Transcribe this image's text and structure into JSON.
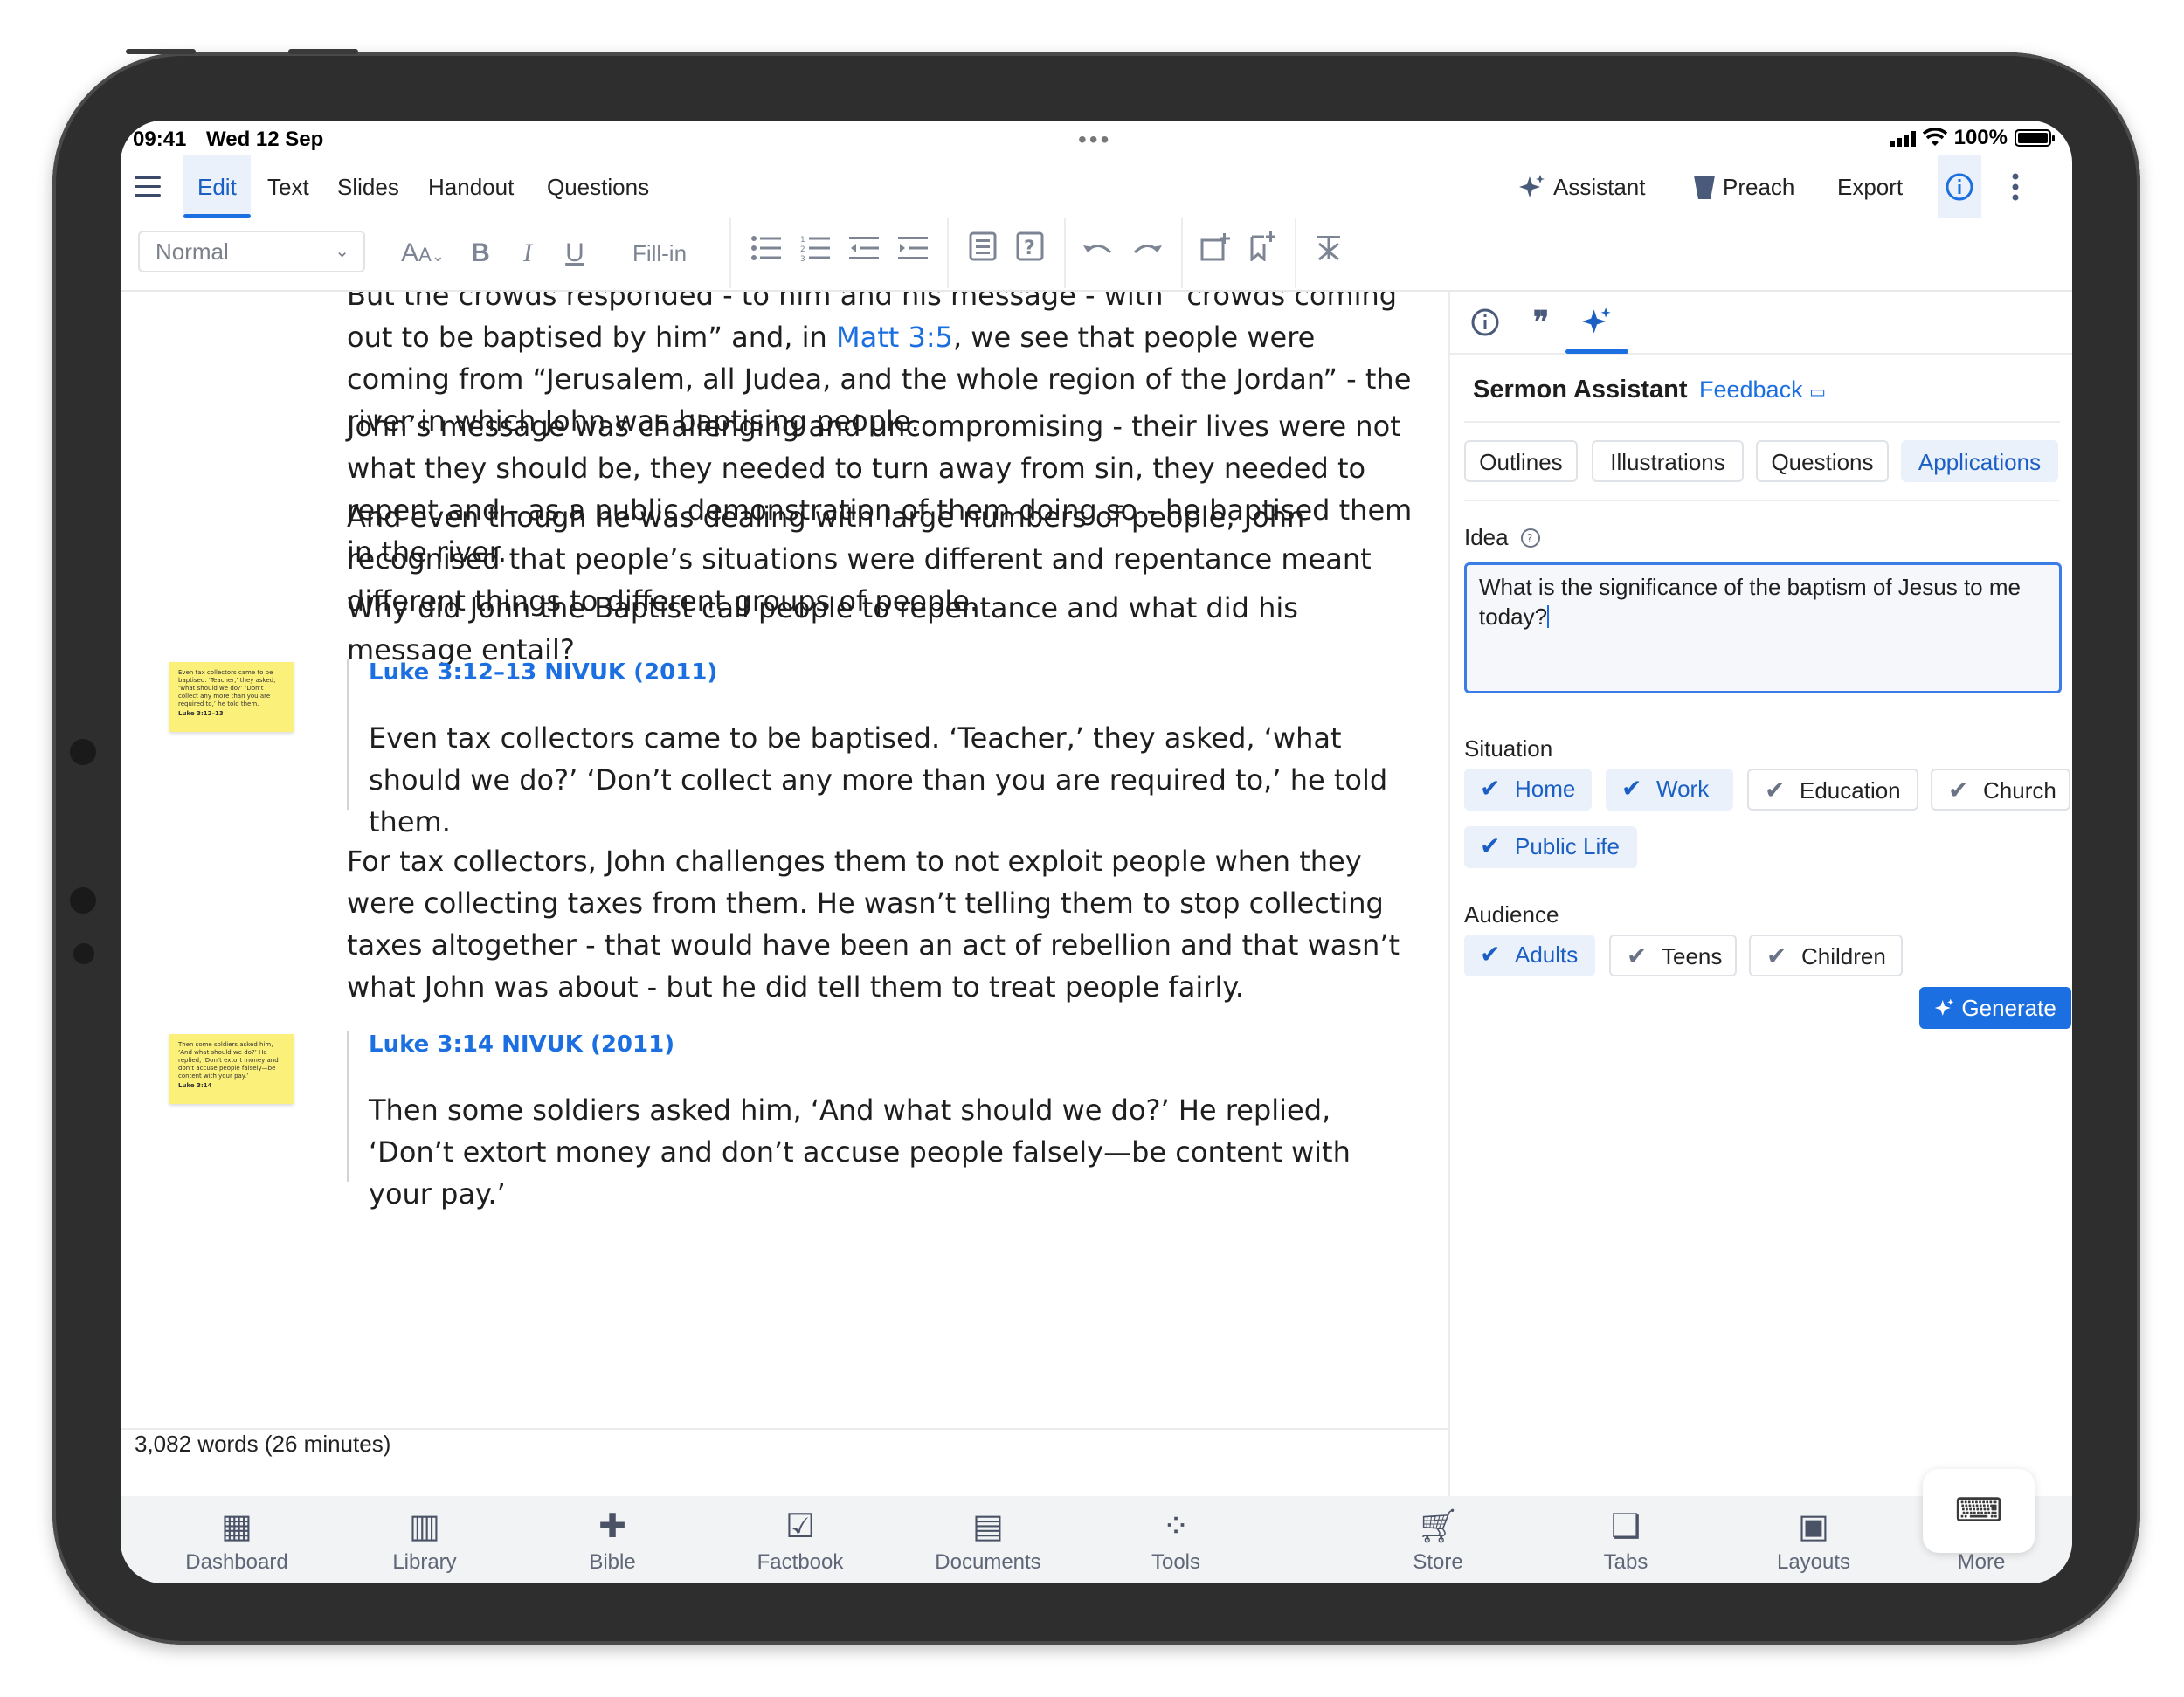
{
  "status": {
    "time": "09:41",
    "date": "Wed 12 Sep",
    "battery": "100%"
  },
  "menu": {
    "tabs": [
      "Edit",
      "Text",
      "Slides",
      "Handout",
      "Questions"
    ],
    "right": {
      "assistant": "Assistant",
      "preach": "Preach",
      "export": "Export"
    }
  },
  "toolbar": {
    "style_value": "Normal",
    "fill_in": "Fill-in"
  },
  "doc": {
    "p1_a": "But the crowds responded - to him and his message - with “crowds coming out to be baptised by him” and, in ",
    "p1_link": "Matt 3:5",
    "p1_b": ", we see that people were coming from “Jerusalem, all Judea, and the whole region of the Jordan” - the river in which John was baptising people.",
    "p2": "John’s message was challenging and uncompromising - their lives were not what they should be, they needed to turn away from sin, they needed to repent and - as a public demonstration of them doing so - he baptised them in the river.",
    "p3": "And even though he was dealing with large numbers of people, John recognised that people’s situations were different and repentance meant different things to different groups of people.",
    "p4": "Why did John the Baptist call people to repentance and what did his message entail?",
    "q1_ref": "Luke 3:12–13 NIVUK (2011)",
    "q1_text": "Even tax collectors came to be baptised. ‘Teacher,’ they asked, ‘what should we do?’ ‘Don’t collect any more than you are required to,’ he told them.",
    "p5": "For tax collectors, John challenges them to not exploit people when they were collecting taxes from them. He wasn’t telling them to stop collecting taxes altogether - that would have been an act of rebellion and that wasn’t what John was about - but he did tell them to treat people fairly.",
    "q2_ref": "Luke 3:14 NIVUK (2011)",
    "q2_text": "Then some soldiers asked him, ‘And what should we do?’ He replied, ‘Don’t extort money and don’t accuse people falsely—be content with your pay.’",
    "sticky1": "Even tax collectors came to be baptised. ‘Teacher,’ they asked, ‘what should we do?’ ‘Don’t collect any more than you are required to,’ he told them.",
    "sticky1_ref": "Luke 3:12–13",
    "sticky2": "Then some soldiers asked him, ‘And what should we do?’ He replied, ‘Don’t extort money and don’t accuse people falsely—be content with your pay.’",
    "sticky2_ref": "Luke 3:14",
    "word_count": "3,082 words (26 minutes)"
  },
  "panel": {
    "title": "Sermon Assistant",
    "feedback": "Feedback",
    "modes": [
      "Outlines",
      "Illustrations",
      "Questions",
      "Applications"
    ],
    "selected_mode": "Applications",
    "idea_label": "Idea",
    "idea_value": "What is the significance of the baptism of Jesus to me today?",
    "situation_label": "Situation",
    "situations": [
      {
        "label": "Home",
        "checked": true
      },
      {
        "label": "Work",
        "checked": true
      },
      {
        "label": "Education",
        "checked": false
      },
      {
        "label": "Church",
        "checked": false
      },
      {
        "label": "Public Life",
        "checked": true
      }
    ],
    "audience_label": "Audience",
    "audiences": [
      {
        "label": "Adults",
        "checked": true
      },
      {
        "label": "Teens",
        "checked": false
      },
      {
        "label": "Children",
        "checked": false
      }
    ],
    "generate": "Generate"
  },
  "dock": [
    "Dashboard",
    "Library",
    "Bible",
    "Factbook",
    "Documents",
    "Tools",
    "Store",
    "Tabs",
    "Layouts",
    "More"
  ],
  "colors": {
    "accent": "#1b6fe0",
    "selected_bg": "#eaf1fb",
    "sticky": "#fbf07a"
  }
}
